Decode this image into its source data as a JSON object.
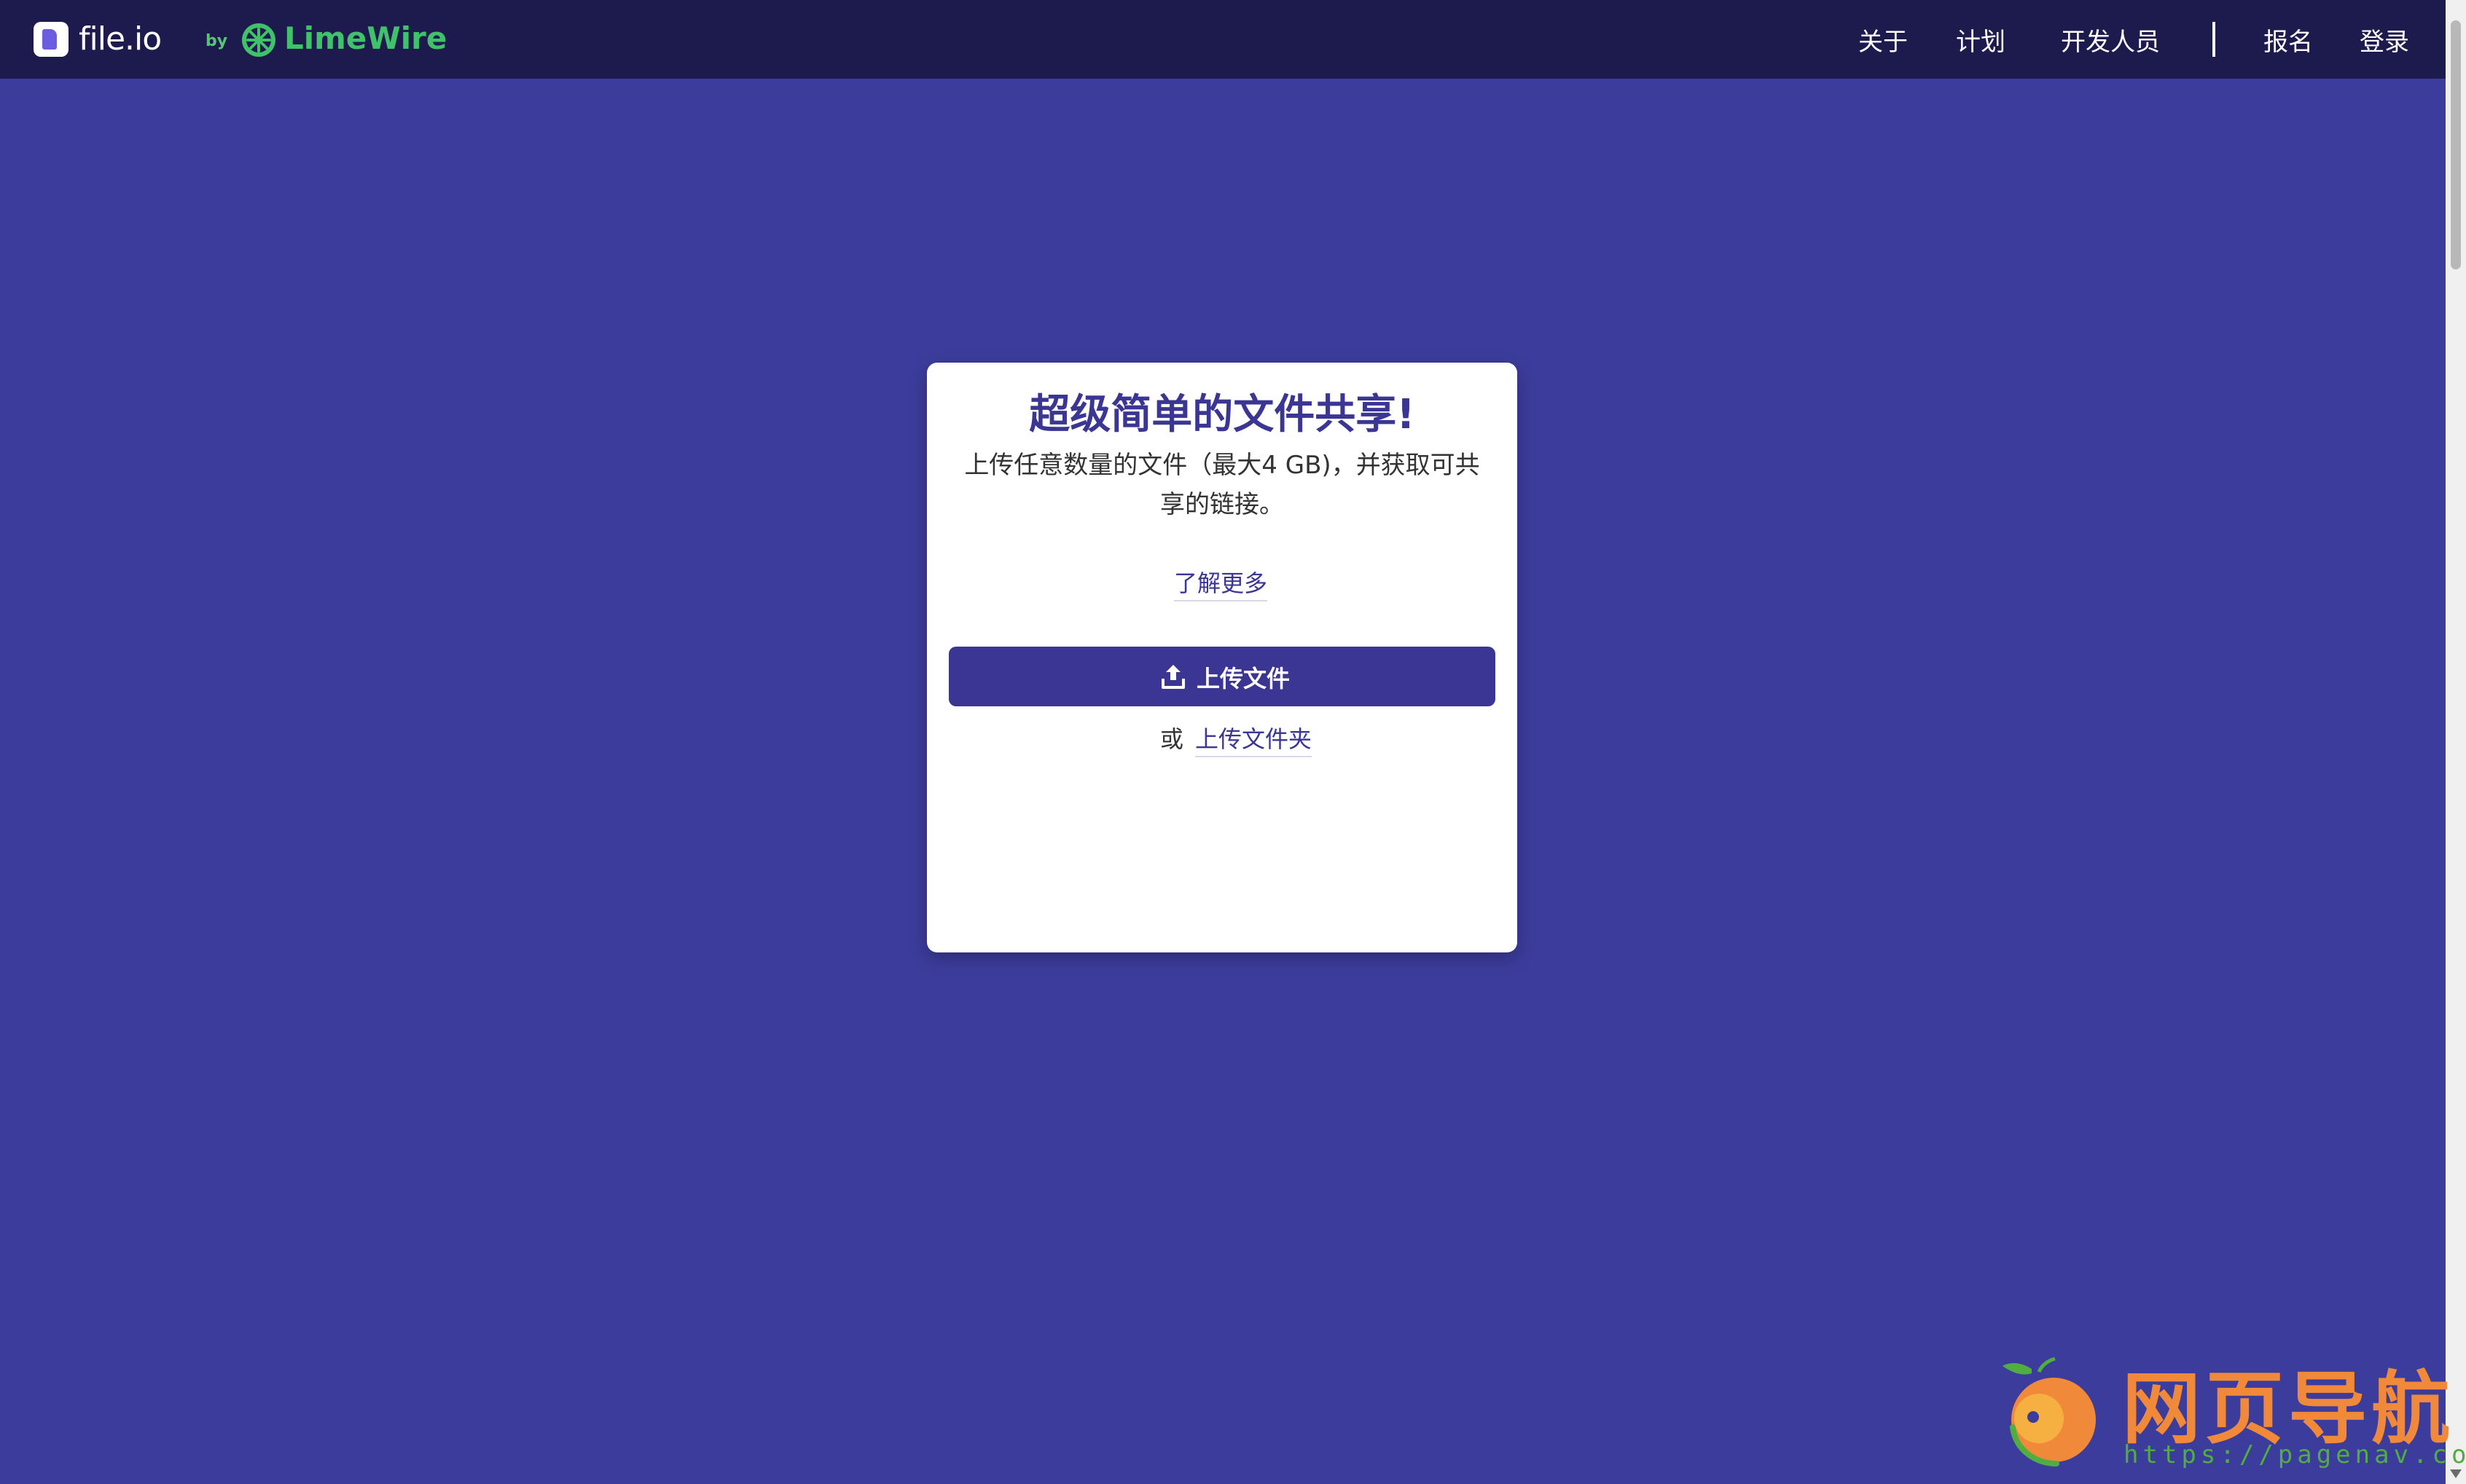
{
  "header": {
    "brand_name": "file.io",
    "brand_by": "by",
    "partner_name": "LimeWire",
    "nav": {
      "about": "关于",
      "plans": "计划",
      "developers": "开发人员",
      "signup": "报名",
      "login": "登录"
    }
  },
  "card": {
    "title": "超级简单的文件共享!",
    "description": "上传任意数量的文件（最大4 GB)，并获取可共享的链接。",
    "learn_more": "了解更多",
    "upload_button": "上传文件",
    "or_text": "或",
    "upload_folder": "上传文件夹"
  },
  "watermark": {
    "title": "网页导航",
    "url": "https://pagenav.com"
  },
  "colors": {
    "page_background": "#3c3c9c",
    "topbar_background": "#1d1b4e",
    "accent": "#3b3594",
    "brand_green": "#3fc26a",
    "watermark_orange": "#f08a3a"
  },
  "icons": {
    "brand": "file-io-logo-icon",
    "partner": "limewire-logo-icon",
    "upload": "upload-icon"
  }
}
